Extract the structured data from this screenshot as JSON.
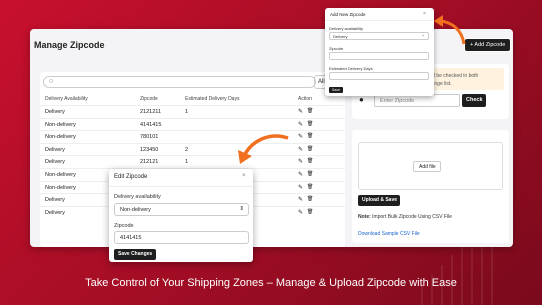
{
  "header": {
    "title": "Manage Zipcode",
    "add_label": "+ Add Zipcode"
  },
  "table": {
    "filter_label": "All",
    "columns": [
      "Delivery Availability",
      "Zipcode",
      "Estimated Delivery Days",
      "Action"
    ],
    "rows": [
      [
        "Delivery",
        "2121211",
        "1"
      ],
      [
        "Non-delivery",
        "4141415",
        ""
      ],
      [
        "Non-delivery",
        "780101",
        ""
      ],
      [
        "Delivery",
        "123450",
        "2"
      ],
      [
        "Delivery",
        "212121",
        "1"
      ],
      [
        "Non-delivery",
        "",
        ""
      ],
      [
        "Non-delivery",
        "",
        ""
      ],
      [
        "Delivery",
        "",
        ""
      ],
      [
        "Delivery",
        "",
        ""
      ]
    ]
  },
  "checker": {
    "warning_line1": "will be checked in both",
    "warning_line2": "Range list.",
    "placeholder": "Enter Zipcode",
    "check_label": "Check"
  },
  "upload": {
    "add_file_label": "Add file",
    "upload_label": "Upload & Save",
    "note_bold": "Note:",
    "note_text": "Import Bulk Zipcode Using CSV File",
    "csv_link": "Download Sample CSV File"
  },
  "add_popup": {
    "title": "Add New Zipcode",
    "close": "×",
    "availability_label": "Delivery availability",
    "availability_value": "Delivery",
    "zipcode_label": "Zipcode",
    "days_label": "Estimated Delivery Days",
    "save_label": "Save"
  },
  "edit_popup": {
    "title": "Edit Zipcode",
    "close": "×",
    "availability_label": "Delivery availability",
    "availability_value": "Non-delivery",
    "zipcode_label": "Zipcode",
    "zipcode_value": "4141415",
    "save_label": "Save Changes"
  },
  "tagline": "Take Control of Your Shipping Zones – Manage & Upload Zipcode with Ease",
  "icons": {
    "edit": "✎",
    "delete": "🗑",
    "pin": "●",
    "search": "○",
    "chevron": "⌃"
  },
  "colors": {
    "background": "#c8102e",
    "accent_arrow": "#f07020",
    "button": "#1e1e1e",
    "link": "#1a66cc"
  }
}
